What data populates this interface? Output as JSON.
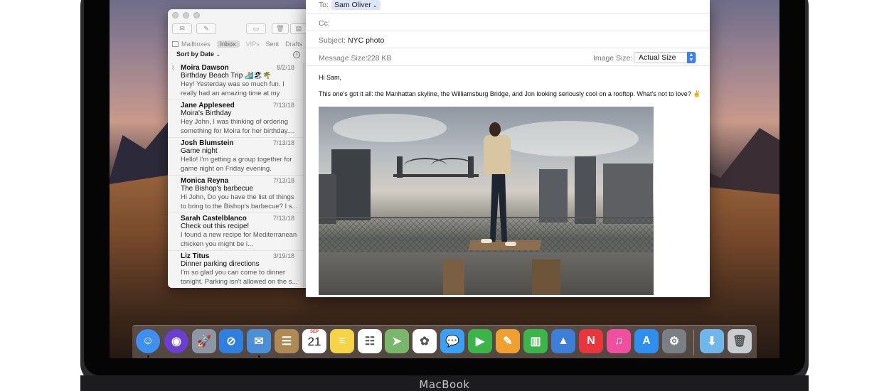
{
  "device": {
    "brand_label": "MacBook"
  },
  "mail_viewer": {
    "favorites": [
      {
        "label": "Mailboxes"
      },
      {
        "label": "Inbox",
        "selected": true
      },
      {
        "label": "VIPs"
      },
      {
        "label": "Sent"
      },
      {
        "label": "Drafts"
      }
    ],
    "sort_label": "Sort by Date",
    "messages": [
      {
        "from": "Moira Dawson",
        "date": "8/2/18",
        "subject": "Birthday Beach Trip 🏄🏖🌴",
        "preview": "Hey! Yesterday was so much fun. I really had an amazing time at my part...",
        "has_attachment": true
      },
      {
        "from": "Jane Appleseed",
        "date": "7/13/18",
        "subject": "Moira's Birthday",
        "preview": "Hey John, I was thinking of ordering something for Moira for her birthday....",
        "has_attachment": false
      },
      {
        "from": "Josh Blumstein",
        "date": "7/13/18",
        "subject": "Game night",
        "preview": "Hello! I'm getting a group together for game night on Friday evening. Wonde...",
        "has_attachment": false
      },
      {
        "from": "Monica Reyna",
        "date": "7/13/18",
        "subject": "The Bishop's barbecue",
        "preview": "Hi John, Do you have the list of things to bring to the Bishop's barbecue? I s...",
        "has_attachment": false
      },
      {
        "from": "Sarah Castelblanco",
        "date": "7/13/18",
        "subject": "Check out this recipe!",
        "preview": "I found a new recipe for Mediterranean chicken you might be i...",
        "has_attachment": false
      },
      {
        "from": "Liz Titus",
        "date": "3/19/18",
        "subject": "Dinner parking directions",
        "preview": "I'm so glad you can come to dinner tonight. Parking isn't allowed on the s...",
        "has_attachment": false
      }
    ]
  },
  "compose": {
    "to_label": "To:",
    "to_value": "Sam Oliver",
    "cc_label": "Cc:",
    "subject_label": "Subject:",
    "subject_value": "NYC photo",
    "message_size_label": "Message Size:",
    "message_size_value": "228 KB",
    "image_size_label": "Image Size:",
    "image_size_value": "Actual Size",
    "greeting": "Hi Sam,",
    "body": "This one's got it all: the Manhattan skyline, the Williamsburg Bridge, and Jon looking seriously cool on a rooftop. What's not to love? ✌"
  },
  "dock": {
    "calendar": {
      "month": "SEP",
      "day": "21"
    },
    "apps": [
      {
        "name": "finder",
        "color": "#3d8ff0",
        "glyph": "☺",
        "running": true
      },
      {
        "name": "siri",
        "color": "#6a3fd0",
        "glyph": "◉",
        "running": false
      },
      {
        "name": "launchpad",
        "color": "#8c96a6",
        "glyph": "🚀",
        "running": false
      },
      {
        "name": "safari",
        "color": "#2f7fe0",
        "glyph": "⊘",
        "running": false
      },
      {
        "name": "mail",
        "color": "#4a8fd8",
        "glyph": "✉",
        "running": true
      },
      {
        "name": "contacts",
        "color": "#b08a55",
        "glyph": "☰",
        "running": false
      },
      {
        "name": "calendar",
        "color": "#ffffff",
        "glyph": "",
        "running": false
      },
      {
        "name": "notes",
        "color": "#f5d547",
        "glyph": "≡",
        "running": false
      },
      {
        "name": "reminders",
        "color": "#ffffff",
        "glyph": "☷",
        "running": false
      },
      {
        "name": "maps",
        "color": "#79b86a",
        "glyph": "➤",
        "running": false
      },
      {
        "name": "photos",
        "color": "#ffffff",
        "glyph": "✿",
        "running": false
      },
      {
        "name": "messages",
        "color": "#3aa0f5",
        "glyph": "💬",
        "running": false
      },
      {
        "name": "facetime",
        "color": "#3bb54a",
        "glyph": "▶",
        "running": false
      },
      {
        "name": "pages",
        "color": "#f0a030",
        "glyph": "✎",
        "running": false
      },
      {
        "name": "numbers",
        "color": "#3bb54a",
        "glyph": "▥",
        "running": false
      },
      {
        "name": "keynote",
        "color": "#3b7fd8",
        "glyph": "▲",
        "running": false
      },
      {
        "name": "news",
        "color": "#e8363c",
        "glyph": "N",
        "running": false
      },
      {
        "name": "itunes",
        "color": "#f04fa0",
        "glyph": "♫",
        "running": false
      },
      {
        "name": "app-store",
        "color": "#2f8ff0",
        "glyph": "A",
        "running": false
      },
      {
        "name": "system-preferences",
        "color": "#7a7f86",
        "glyph": "⚙",
        "running": false
      },
      {
        "name": "downloads-folder",
        "color": "#6fb6ea",
        "glyph": "⬇",
        "running": false
      },
      {
        "name": "trash",
        "color": "#c9cdd1",
        "glyph": "🗑",
        "running": false
      }
    ]
  }
}
